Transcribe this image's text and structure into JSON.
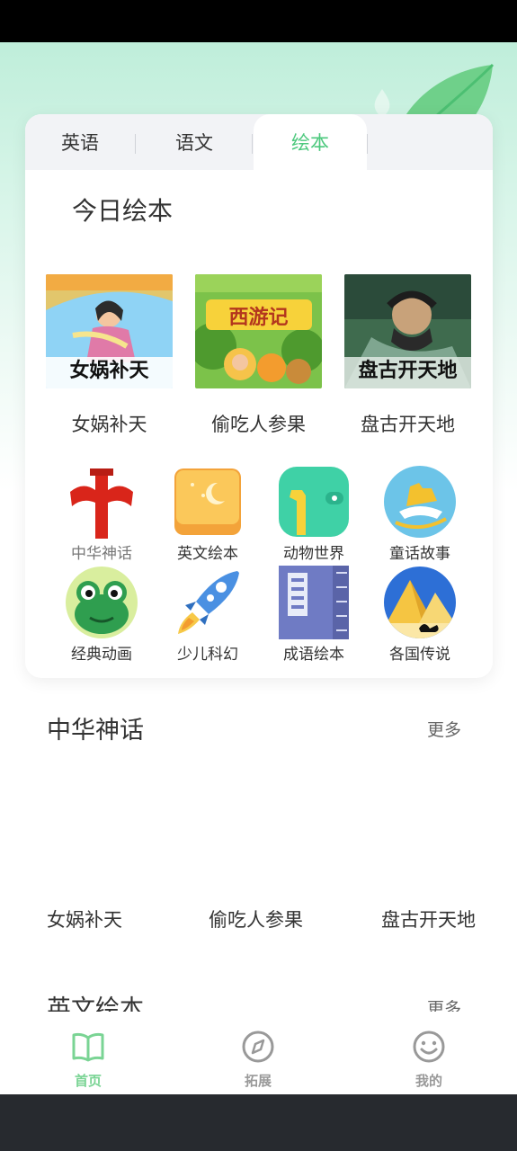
{
  "tabs": [
    {
      "label": "英语",
      "active": false
    },
    {
      "label": "语文",
      "active": false
    },
    {
      "label": "绘本",
      "active": true
    }
  ],
  "card": {
    "title": "今日绘本",
    "books": [
      {
        "title": "女娲补天",
        "cover_text": "女娲补天"
      },
      {
        "title": "偷吃人参果",
        "cover_text": "西游记"
      },
      {
        "title": "盘古开天地",
        "cover_text": "盘古开天地"
      }
    ],
    "categories": [
      {
        "label": "中华神话",
        "icon": "pillar-icon"
      },
      {
        "label": "英文绘本",
        "icon": "book-moon-icon"
      },
      {
        "label": "动物世界",
        "icon": "giraffe-icon"
      },
      {
        "label": "童话故事",
        "icon": "rocking-horse-icon"
      },
      {
        "label": "经典动画",
        "icon": "frog-icon"
      },
      {
        "label": "少儿科幻",
        "icon": "rocket-icon"
      },
      {
        "label": "成语绘本",
        "icon": "idiom-book-icon"
      },
      {
        "label": "各国传说",
        "icon": "pyramid-icon"
      }
    ]
  },
  "section1": {
    "title": "中华神话",
    "more": "更多",
    "books": [
      "女娲补天",
      "偷吃人参果",
      "盘古开天地"
    ]
  },
  "section2": {
    "title": "英文绘本",
    "more": "更多"
  },
  "nav": [
    {
      "label": "首页",
      "icon": "book-open-icon",
      "active": true
    },
    {
      "label": "拓展",
      "icon": "compass-icon",
      "active": false
    },
    {
      "label": "我的",
      "icon": "smiley-icon",
      "active": false
    }
  ],
  "colors": {
    "accent": "#4cc87d",
    "nav_active": "#7ad494"
  }
}
